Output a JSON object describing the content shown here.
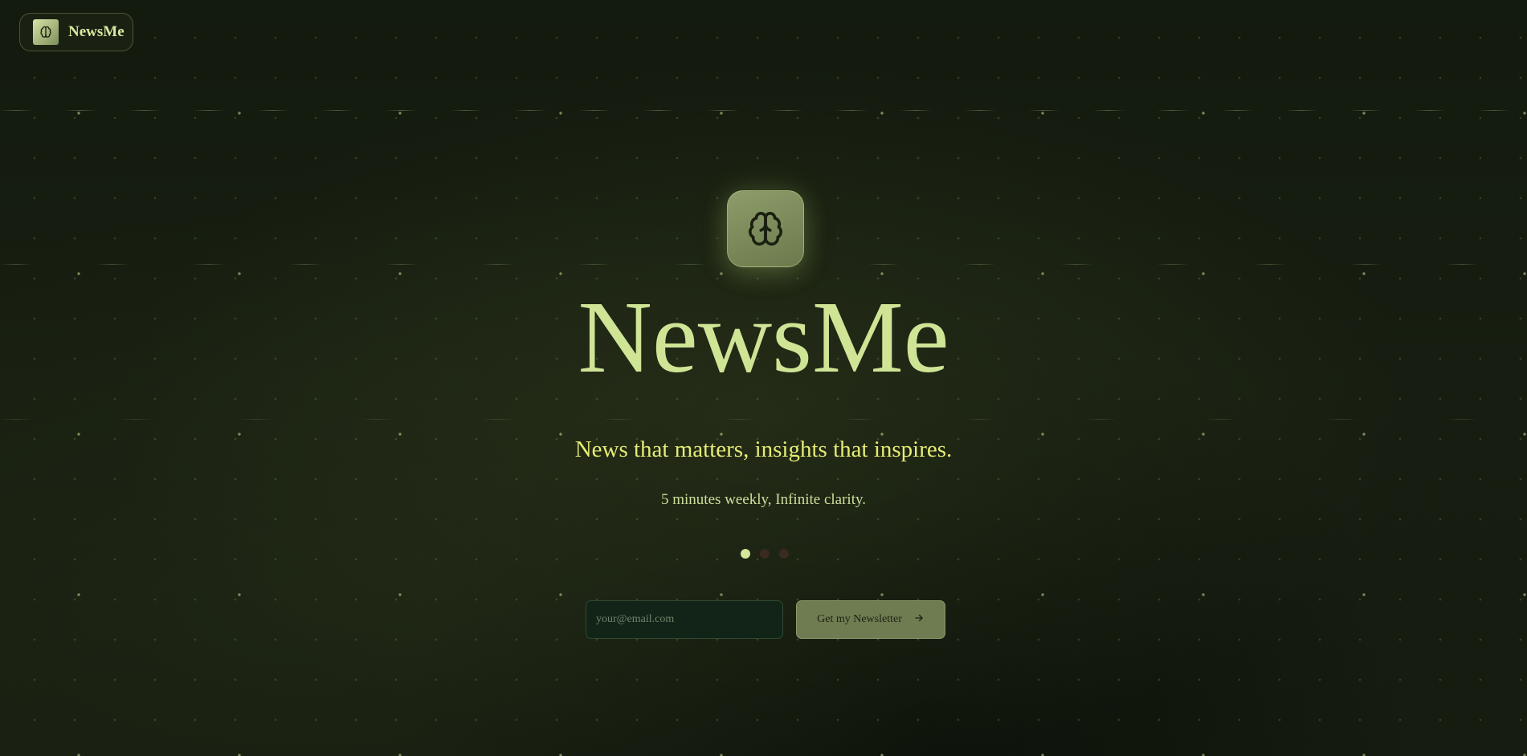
{
  "brand": {
    "name": "NewsMe",
    "logo_icon": "brain-icon"
  },
  "hero": {
    "icon": "brain-icon",
    "title": "NewsMe",
    "tagline": "News that matters, insights that inspires.",
    "subtagline": "5 minutes weekly, Infinite clarity."
  },
  "carousel": {
    "count": 3,
    "active_index": 0
  },
  "signup": {
    "email_placeholder": "your@email.com",
    "email_value": "",
    "button_label": "Get my Newsletter",
    "button_icon": "arrow-right-icon"
  },
  "colors": {
    "background": "#141a0e",
    "accent": "#cfe495",
    "tagline": "#e6ec74",
    "button": "#6f7c52",
    "input_bg": "#122418"
  }
}
